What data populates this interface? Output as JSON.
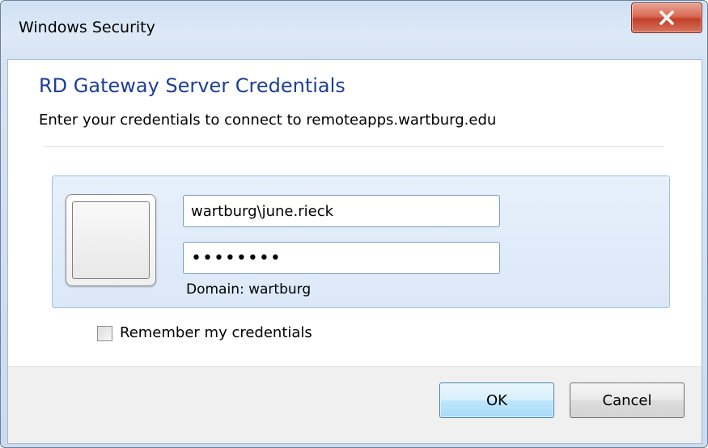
{
  "window": {
    "title": "Windows Security"
  },
  "dialog": {
    "heading": "RD Gateway Server Credentials",
    "subheading": "Enter your credentials to connect to remoteapps.wartburg.edu"
  },
  "credentials": {
    "username_value": "wartburg\\june.rieck",
    "password_value": "••••••••",
    "domain_label": "Domain: wartburg"
  },
  "remember": {
    "label": "Remember my credentials",
    "checked": false
  },
  "buttons": {
    "ok_label": "OK",
    "cancel_label": "Cancel"
  },
  "icons": {
    "close": "close-icon",
    "user_tile": "user-tile-icon",
    "checkbox": "checkbox-icon"
  },
  "colors": {
    "heading": "#1c3e96",
    "close_button": "#c13f28",
    "tile_border": "#9fc0e3"
  }
}
